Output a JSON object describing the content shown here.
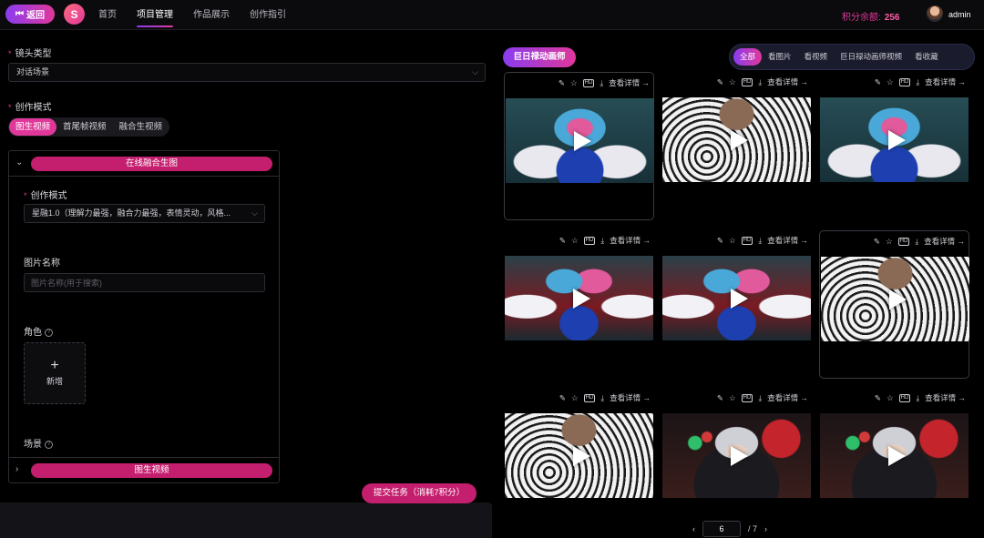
{
  "topbar": {
    "back_label": "返回",
    "logo_glyph": "S",
    "nav": [
      "首页",
      "项目管理",
      "作品展示",
      "创作指引"
    ],
    "nav_active_index": 1,
    "credits_label": "积分余额:",
    "credits_value": "256",
    "username": "admin"
  },
  "form": {
    "shot_type_label": "镜头类型",
    "shot_type_value": "对话场景",
    "mode_label": "创作模式",
    "mode_tabs": [
      "图生视频",
      "首尾帧视频",
      "融合生视频"
    ],
    "mode_active_index": 0,
    "panel_top_button": "在线融合生图",
    "inner_mode_label": "创作模式",
    "inner_mode_value": "星融1.0（理解力最强，融合力最强，表情灵动，风格...",
    "image_name_label": "图片名称",
    "image_name_placeholder": "图片名称(用于搜索)",
    "role_label": "角色",
    "add_label": "新增",
    "scene_label": "场景",
    "panel_bottom_button": "图生视频",
    "submit_label": "提交任务（消耗7积分）"
  },
  "gallery": {
    "brand_label": "巨日禄动画师",
    "filters": [
      "全部",
      "看图片",
      "看视频",
      "巨日禄动画师视频",
      "看收藏"
    ],
    "filter_active_index": 0,
    "detail_label": "查看详情",
    "hd_label": "HD",
    "items": [
      {
        "style": "teal",
        "bordered": true
      },
      {
        "style": "white",
        "bordered": false
      },
      {
        "style": "teal",
        "bordered": false
      },
      {
        "style": "teal2",
        "bordered": false
      },
      {
        "style": "teal2",
        "bordered": false
      },
      {
        "style": "white",
        "bordered": true
      },
      {
        "style": "white",
        "bordered": false
      },
      {
        "style": "dark",
        "bordered": false
      },
      {
        "style": "dark",
        "bordered": false
      }
    ]
  },
  "pagination": {
    "current": "6",
    "total_text": "/ 7"
  },
  "colors": {
    "accent": "#e0389a",
    "accent_dark": "#c41e6e",
    "gradient_start": "#8a3cf0"
  }
}
